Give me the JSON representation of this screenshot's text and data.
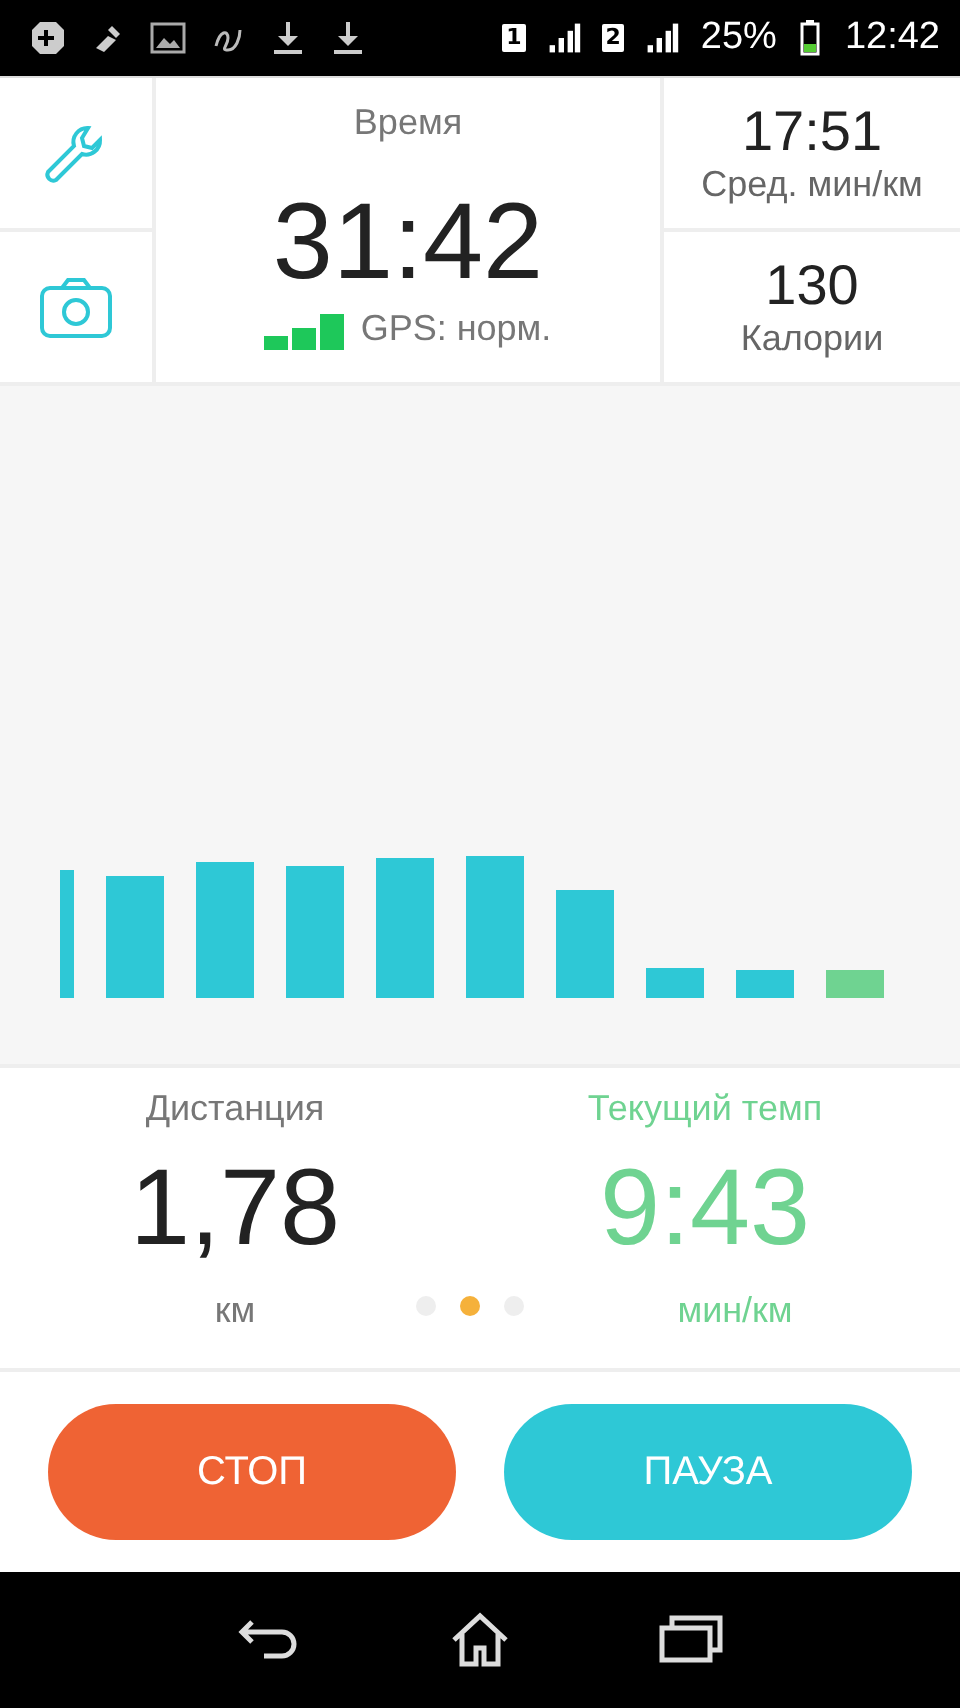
{
  "status_bar": {
    "sims": [
      "1",
      "2"
    ],
    "battery": "25%",
    "time": "12:42"
  },
  "time_panel": {
    "label": "Время",
    "value": "31:42",
    "gps": "GPS: норм."
  },
  "side_stats": [
    {
      "value": "17:51",
      "label": "Сред. мин/км"
    },
    {
      "value": "130",
      "label": "Калории"
    }
  ],
  "stats": [
    {
      "label": "Дистанция",
      "value": "1,78",
      "unit": "км",
      "kind": "plain"
    },
    {
      "label": "Текущий темп",
      "value": "9:43",
      "unit": "мин/км",
      "kind": "accent"
    }
  ],
  "pager": [
    {
      "selected": false
    },
    {
      "selected": true
    },
    {
      "selected": false
    }
  ],
  "buttons": [
    {
      "label": "СТОП",
      "kind": "stop"
    },
    {
      "label": "ПАУЗА",
      "kind": "pause"
    }
  ]
}
